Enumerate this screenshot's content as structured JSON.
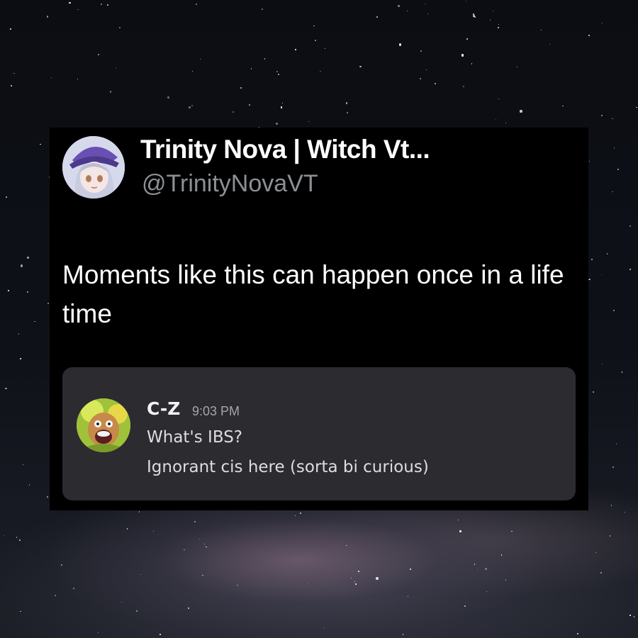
{
  "tweet": {
    "display_name": "Trinity Nova | Witch Vt...",
    "handle": "@TrinityNovaVT",
    "text": "Moments like this can happen once in a life time",
    "avatar_icon": "anime-witch-avatar"
  },
  "discord_message": {
    "author": "C-Z",
    "time": "9:03 PM",
    "lines": [
      "What's IBS?",
      "Ignorant cis here (sorta bi curious)"
    ],
    "avatar_icon": "cartoon-character-avatar"
  },
  "colors": {
    "card_bg": "#000000",
    "embed_bg": "#2b2b30",
    "handle_gray": "#8b9096",
    "message_text": "#dbdee1"
  }
}
